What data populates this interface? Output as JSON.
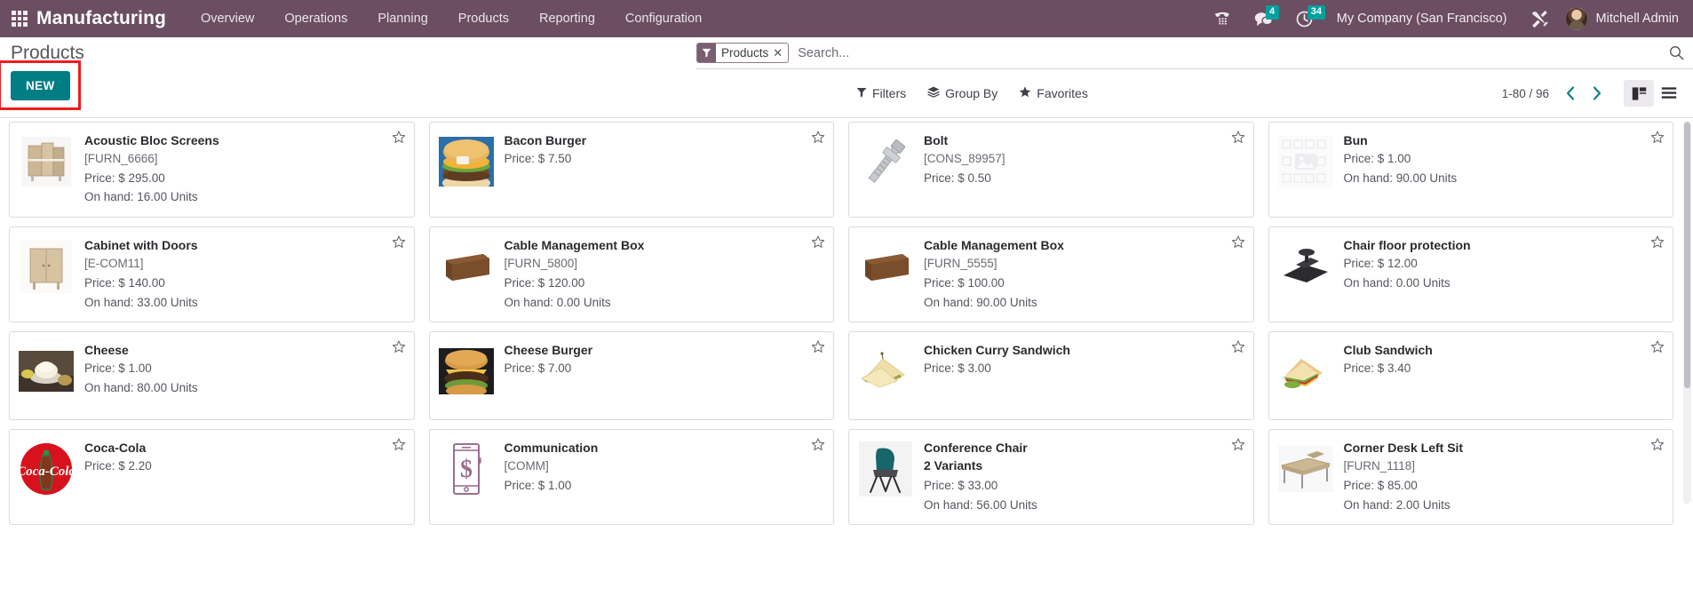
{
  "navbar": {
    "apps_icon": "apps-grid-icon",
    "brand": "Manufacturing",
    "menu": [
      {
        "label": "Overview"
      },
      {
        "label": "Operations"
      },
      {
        "label": "Planning"
      },
      {
        "label": "Products"
      },
      {
        "label": "Reporting"
      },
      {
        "label": "Configuration"
      }
    ],
    "systray": {
      "voip_icon": "phone-keypad-icon",
      "messages_icon": "chat-bubble-icon",
      "messages_count": "4",
      "activities_icon": "clock-icon",
      "activities_count": "34",
      "company": "My Company (San Francisco)",
      "tools_icon": "wrench-screwdriver-icon",
      "avatar_icon": "user-avatar",
      "user": "Mitchell Admin"
    },
    "colors": {
      "background": "#6b4e61",
      "badge": "#00a09d"
    }
  },
  "control_panel": {
    "breadcrumb": "Products",
    "new_label": "NEW",
    "new_color": "#017e84",
    "highlight_color": "#f01c1c",
    "search": {
      "facet_label": "Products",
      "facet_icon": "filter-funnel-icon",
      "facet_remove_icon": "close-icon",
      "placeholder": "Search...",
      "value": "",
      "search_icon": "magnifier-icon"
    },
    "filters": [
      {
        "label": "Filters",
        "icon": "filter-funnel-icon"
      },
      {
        "label": "Group By",
        "icon": "layers-icon"
      },
      {
        "label": "Favorites",
        "icon": "star-icon"
      }
    ],
    "pager": {
      "range": "1-80 / 96",
      "prev_icon": "chevron-left-icon",
      "next_icon": "chevron-right-icon"
    },
    "views": [
      {
        "name": "kanban",
        "icon": "kanban-view-icon",
        "active": true
      },
      {
        "name": "list",
        "icon": "list-view-icon",
        "active": false
      }
    ]
  },
  "kanban": {
    "cards": [
      {
        "title": "Acoustic Bloc Screens",
        "ref": "[FURN_6666]",
        "price": "Price: $ 295.00",
        "onhand": "On hand: 16.00 Units",
        "variants": "",
        "thumb": "screen-divider-image",
        "star_icon": "star-outline-icon"
      },
      {
        "title": "Bacon Burger",
        "ref": "",
        "price": "Price: $ 7.50",
        "onhand": "",
        "variants": "",
        "thumb": "burger-image",
        "star_icon": "star-outline-icon"
      },
      {
        "title": "Bolt",
        "ref": "[CONS_89957]",
        "price": "Price: $ 0.50",
        "onhand": "",
        "variants": "",
        "thumb": "bolt-image",
        "star_icon": "star-outline-icon"
      },
      {
        "title": "Bun",
        "ref": "",
        "price": "Price: $ 1.00",
        "onhand": "On hand: 90.00 Units",
        "variants": "",
        "thumb": "image-placeholder",
        "star_icon": "star-outline-icon"
      },
      {
        "title": "Cabinet with Doors",
        "ref": "[E-COM11]",
        "price": "Price: $ 140.00",
        "onhand": "On hand: 33.00 Units",
        "variants": "",
        "thumb": "cabinet-image",
        "star_icon": "star-outline-icon"
      },
      {
        "title": "Cable Management Box",
        "ref": "[FURN_5800]",
        "price": "Price: $ 120.00",
        "onhand": "On hand: 0.00 Units",
        "variants": "",
        "thumb": "cable-box-image",
        "star_icon": "star-outline-icon"
      },
      {
        "title": "Cable Management Box",
        "ref": "[FURN_5555]",
        "price": "Price: $ 100.00",
        "onhand": "On hand: 90.00 Units",
        "variants": "",
        "thumb": "cable-box-image",
        "star_icon": "star-outline-icon"
      },
      {
        "title": "Chair floor protection",
        "ref": "",
        "price": "Price: $ 12.00",
        "onhand": "On hand: 0.00 Units",
        "variants": "",
        "thumb": "floor-mat-image",
        "star_icon": "star-outline-icon"
      },
      {
        "title": "Cheese",
        "ref": "",
        "price": "Price: $ 1.00",
        "onhand": "On hand: 80.00 Units",
        "variants": "",
        "thumb": "cheese-image",
        "star_icon": "star-outline-icon"
      },
      {
        "title": "Cheese Burger",
        "ref": "",
        "price": "Price: $ 7.00",
        "onhand": "",
        "variants": "",
        "thumb": "cheeseburger-image",
        "star_icon": "star-outline-icon"
      },
      {
        "title": "Chicken Curry Sandwich",
        "ref": "",
        "price": "Price: $ 3.00",
        "onhand": "",
        "variants": "",
        "thumb": "sandwich-image",
        "star_icon": "star-outline-icon"
      },
      {
        "title": "Club Sandwich",
        "ref": "",
        "price": "Price: $ 3.40",
        "onhand": "",
        "variants": "",
        "thumb": "club-sandwich-image",
        "star_icon": "star-outline-icon"
      },
      {
        "title": "Coca-Cola",
        "ref": "",
        "price": "Price: $ 2.20",
        "onhand": "",
        "variants": "",
        "thumb": "coca-cola-image",
        "star_icon": "star-outline-icon"
      },
      {
        "title": "Communication",
        "ref": "[COMM]",
        "price": "Price: $ 1.00",
        "onhand": "",
        "variants": "",
        "thumb": "phone-dollar-image",
        "star_icon": "star-outline-icon"
      },
      {
        "title": "Conference Chair",
        "ref": "",
        "price": "Price: $ 33.00",
        "onhand": "On hand: 56.00 Units",
        "variants": "2 Variants",
        "thumb": "chair-image",
        "star_icon": "star-outline-icon"
      },
      {
        "title": "Corner Desk Left Sit",
        "ref": "[FURN_1118]",
        "price": "Price: $ 85.00",
        "onhand": "On hand: 2.00 Units",
        "variants": "",
        "thumb": "desk-image",
        "star_icon": "star-outline-icon"
      }
    ]
  }
}
